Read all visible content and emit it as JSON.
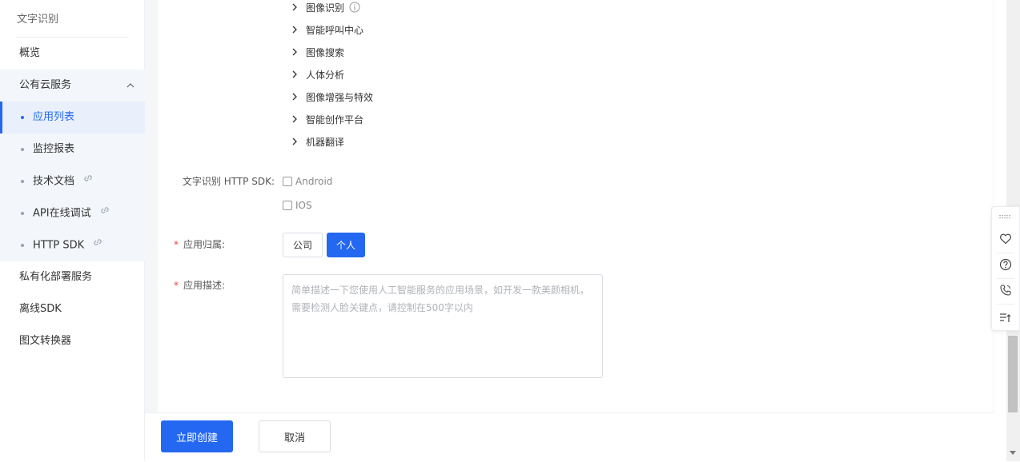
{
  "sidebar": {
    "title": "文字识别",
    "items": [
      {
        "label": "概览"
      },
      {
        "label": "公有云服务"
      },
      {
        "label": "私有化部署服务"
      },
      {
        "label": "离线SDK"
      },
      {
        "label": "图文转换器"
      }
    ],
    "sub_items": [
      {
        "label": "应用列表",
        "active": true
      },
      {
        "label": "监控报表"
      },
      {
        "label": "技术文档",
        "external": true
      },
      {
        "label": "API在线调试",
        "external": true
      },
      {
        "label": "HTTP SDK",
        "external": true
      }
    ]
  },
  "tree": {
    "items": [
      {
        "label": "图像识别",
        "info": true
      },
      {
        "label": "智能呼叫中心"
      },
      {
        "label": "图像搜索"
      },
      {
        "label": "人体分析"
      },
      {
        "label": "图像增强与特效"
      },
      {
        "label": "智能创作平台"
      },
      {
        "label": "机器翻译"
      }
    ]
  },
  "form": {
    "sdk_label": "文字识别 HTTP SDK:",
    "sdk_options": [
      "Android",
      "IOS"
    ],
    "ownership_label": "应用归属:",
    "ownership_options": [
      "公司",
      "个人"
    ],
    "ownership_selected": "个人",
    "description_label": "应用描述:",
    "description_placeholder": "简单描述一下您使用人工智能服务的应用场景，如开发一款美颜相机，\n需要检测人脸关键点，请控制在500字以内"
  },
  "footer": {
    "create_label": "立即创建",
    "cancel_label": "取消"
  },
  "colors": {
    "primary": "#2468f2",
    "required": "#f33e3e"
  },
  "tools": [
    "drag-handle-icon",
    "heart-icon",
    "help-icon",
    "phone-icon",
    "notes-icon"
  ]
}
